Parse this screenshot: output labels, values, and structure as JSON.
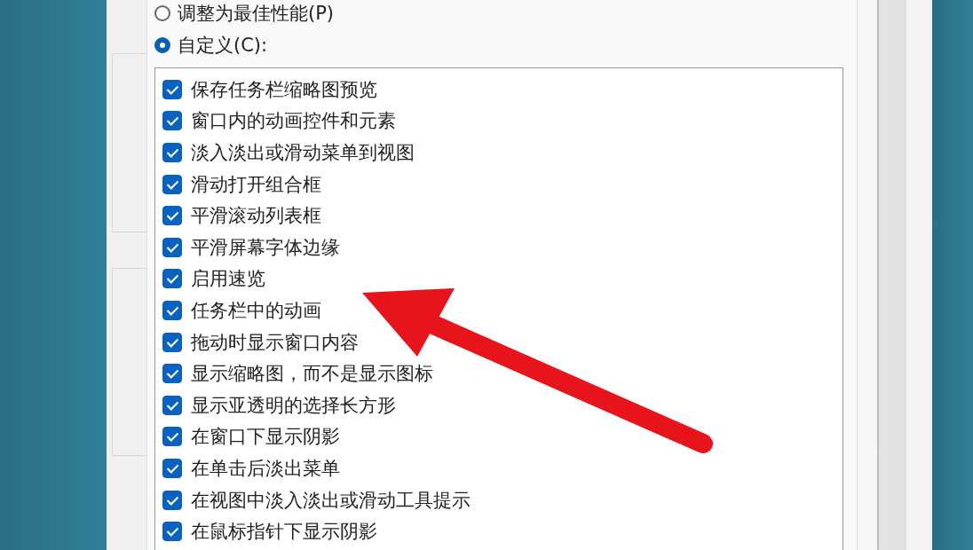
{
  "options": [
    {
      "label": "调整为最佳性能(P)",
      "selected": false
    },
    {
      "label": "自定义(C):",
      "selected": true
    }
  ],
  "effects": [
    {
      "label": "保存任务栏缩略图预览",
      "checked": true
    },
    {
      "label": "窗口内的动画控件和元素",
      "checked": true
    },
    {
      "label": "淡入淡出或滑动菜单到视图",
      "checked": true
    },
    {
      "label": "滑动打开组合框",
      "checked": true
    },
    {
      "label": "平滑滚动列表框",
      "checked": true
    },
    {
      "label": "平滑屏幕字体边缘",
      "checked": true
    },
    {
      "label": "启用速览",
      "checked": true
    },
    {
      "label": "任务栏中的动画",
      "checked": true
    },
    {
      "label": "拖动时显示窗口内容",
      "checked": true
    },
    {
      "label": "显示缩略图，而不是显示图标",
      "checked": true
    },
    {
      "label": "显示亚透明的选择长方形",
      "checked": true
    },
    {
      "label": "在窗口下显示阴影",
      "checked": true
    },
    {
      "label": "在单击后淡出菜单",
      "checked": true
    },
    {
      "label": "在视图中淡入淡出或滑动工具提示",
      "checked": true
    },
    {
      "label": "在鼠标指针下显示阴影",
      "checked": true
    }
  ]
}
